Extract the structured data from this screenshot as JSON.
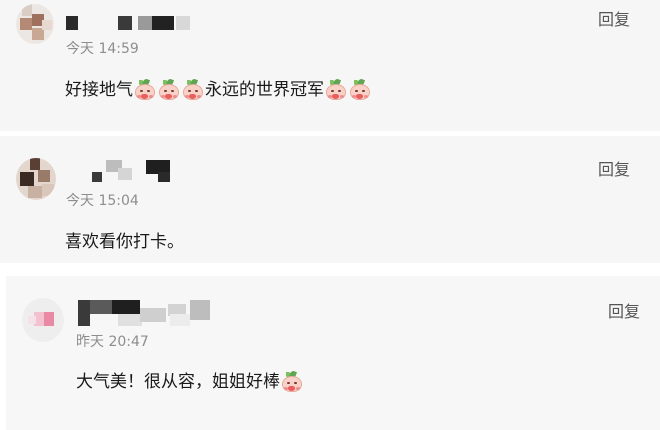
{
  "comments": [
    {
      "time": "今天 14:59",
      "reply_label": "回复",
      "text_before": "好接地气",
      "text_after": "永远的世界冠军",
      "emoji_before_count": 3,
      "emoji_after_count": 2,
      "emoji_icon": "peach-emoji-icon"
    },
    {
      "time": "今天 15:04",
      "reply_label": "回复",
      "text": "喜欢看你打卡。"
    },
    {
      "time": "昨天 20:47",
      "reply_label": "回复",
      "text": "大气美！很从容，姐姐好棒",
      "emoji_after_count": 1,
      "emoji_icon": "peach-emoji-icon"
    }
  ],
  "colors": {
    "card_bg": "#f6f6f6",
    "time_text": "#8e8e8e",
    "reply_text": "#555555",
    "comment_text": "#1a1a1a"
  }
}
